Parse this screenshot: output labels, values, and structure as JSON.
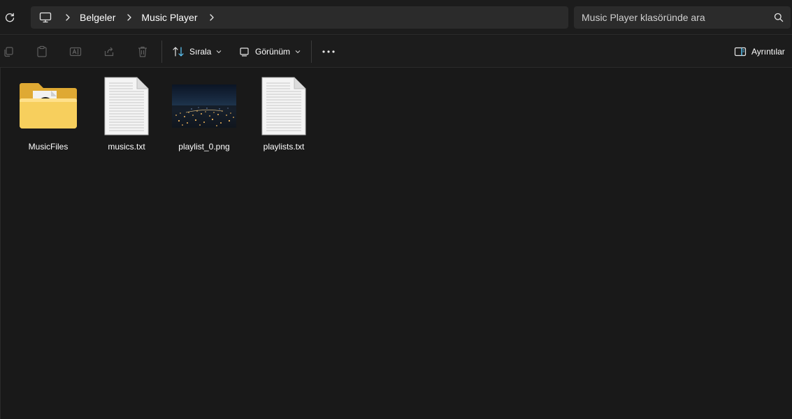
{
  "breadcrumb": {
    "items": [
      {
        "label": "Belgeler"
      },
      {
        "label": "Music Player"
      }
    ]
  },
  "search": {
    "placeholder": "Music Player klasöründe ara"
  },
  "toolbar": {
    "sort_label": "Sırala",
    "view_label": "Görünüm",
    "details_label": "Ayrıntılar"
  },
  "files": [
    {
      "name": "MusicFiles",
      "type": "folder"
    },
    {
      "name": "musics.txt",
      "type": "text-file"
    },
    {
      "name": "playlist_0.png",
      "type": "image-file"
    },
    {
      "name": "playlists.txt",
      "type": "text-file"
    }
  ],
  "colors": {
    "background": "#191919",
    "bar": "#1c1c1c",
    "field": "#2b2b2b",
    "accent": "#60cdff",
    "folder": "#f5c84c"
  }
}
